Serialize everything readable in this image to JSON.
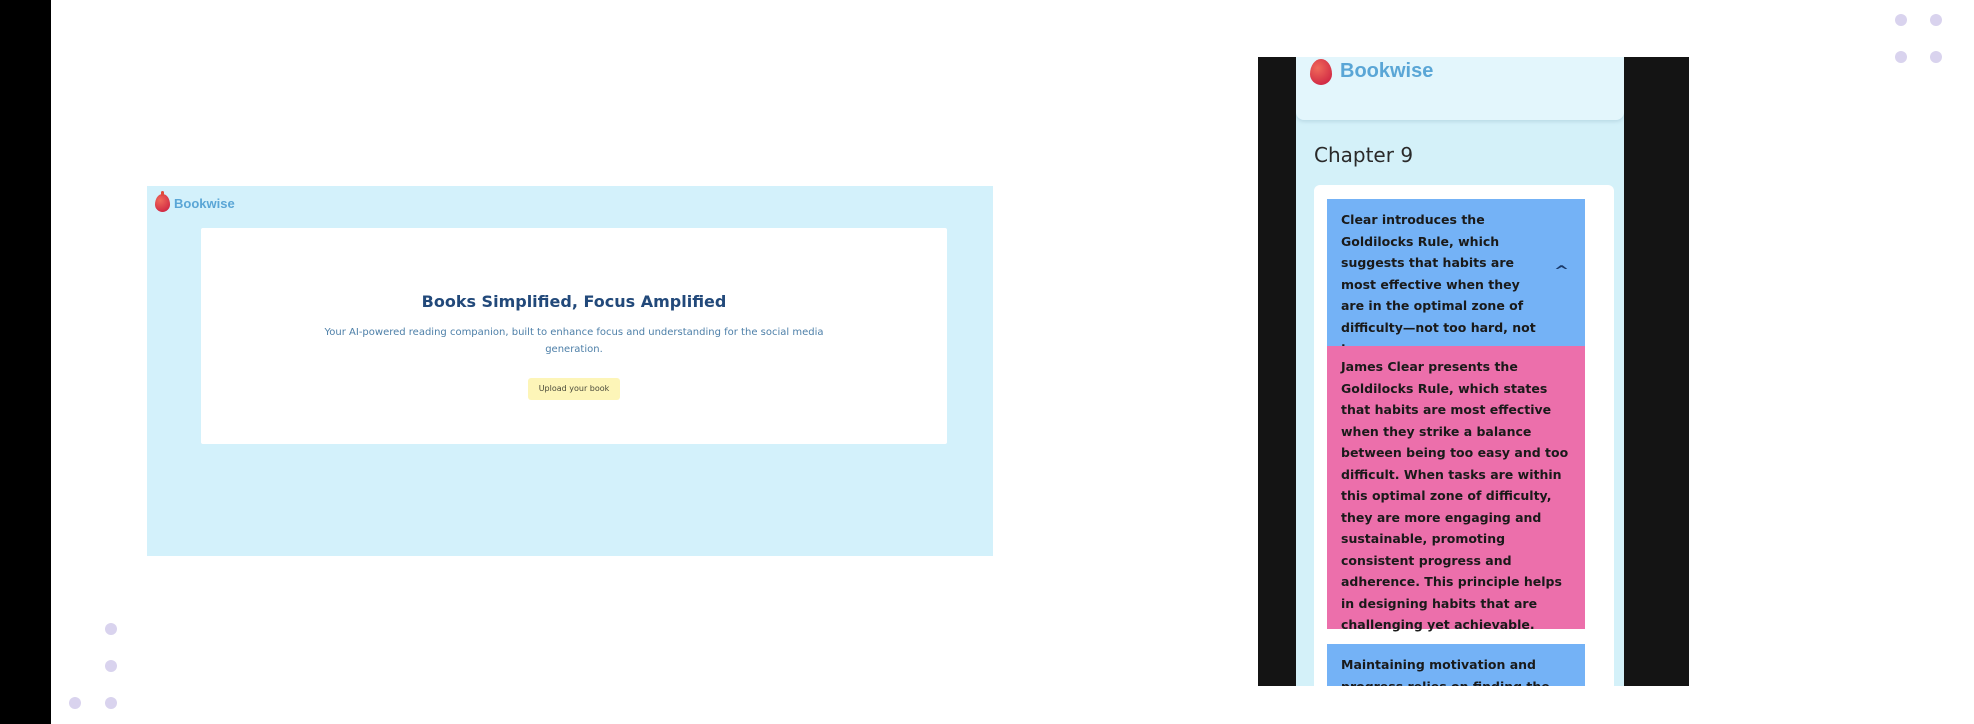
{
  "desktop": {
    "brand": "Bookwise",
    "hero_title": "Books Simplified, Focus Amplified",
    "hero_subtitle": "Your AI-powered reading companion, built to enhance focus and understanding for the social media generation.",
    "upload_button": "Upload your book"
  },
  "mobile": {
    "brand": "Bookwise",
    "chapter": "Chapter 9",
    "cards": [
      {
        "text": "Clear introduces the Goldilocks Rule, which suggests that habits are most effective when they are in the optimal zone of difficulty—not too hard, not too easy.",
        "color": "#74b2f6",
        "expanded": true
      },
      {
        "text": "James Clear presents the Goldilocks Rule, which states that habits are most effective when they strike a balance between being too easy and too difficult. When tasks are within this optimal zone of difficulty, they are more engaging and sustainable, promoting consistent progress and adherence. This principle helps in designing habits that are challenging yet achievable.",
        "color": "#ec6fab"
      },
      {
        "text": "Maintaining motivation and progress relies on finding the",
        "color": "#74b2f6"
      }
    ]
  },
  "colors": {
    "desktop_background": "#d3f1fb",
    "card_blue": "#74b2f6",
    "card_pink": "#ec6fab",
    "brand_text": "#5aa6d6",
    "upload_button": "#fdf5b8"
  }
}
